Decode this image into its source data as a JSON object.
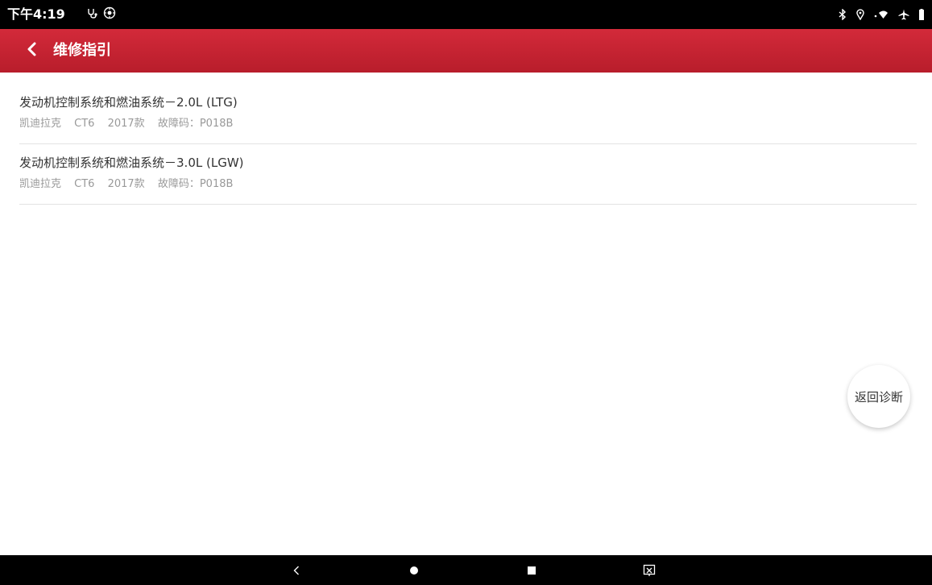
{
  "status_bar": {
    "time": "下午4:19",
    "left_icons": [
      "stethoscope-icon",
      "notification-badge-icon"
    ],
    "right_icons": [
      "bluetooth-icon",
      "location-icon",
      "wifi-icon",
      "airplane-icon",
      "battery-icon"
    ]
  },
  "app_bar": {
    "title": "维修指引",
    "back_icon": "chevron-left-icon",
    "color": "#c8202f"
  },
  "results": [
    {
      "title": "发动机控制系统和燃油系统－2.0L (LTG)",
      "brand": "凯迪拉克",
      "model": "CT6",
      "year": "2017款",
      "fault_code": "故障码：P018B"
    },
    {
      "title": "发动机控制系统和燃油系统－3.0L (LGW)",
      "brand": "凯迪拉克",
      "model": "CT6",
      "year": "2017款",
      "fault_code": "故障码：P018B"
    }
  ],
  "fab": {
    "label": "返回诊断"
  },
  "nav_bar": {
    "icons": [
      "nav-back-icon",
      "nav-home-icon",
      "nav-recents-icon",
      "screenshot-icon"
    ]
  }
}
